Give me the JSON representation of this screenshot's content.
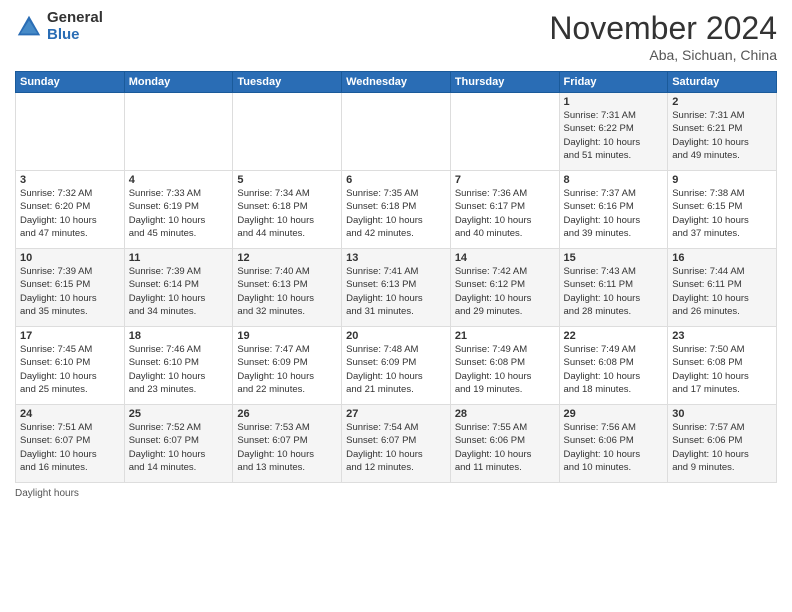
{
  "logo": {
    "general": "General",
    "blue": "Blue"
  },
  "header": {
    "month": "November 2024",
    "location": "Aba, Sichuan, China"
  },
  "days_of_week": [
    "Sunday",
    "Monday",
    "Tuesday",
    "Wednesday",
    "Thursday",
    "Friday",
    "Saturday"
  ],
  "footer": {
    "text": "Daylight hours"
  },
  "weeks": [
    [
      {
        "day": "",
        "detail": ""
      },
      {
        "day": "",
        "detail": ""
      },
      {
        "day": "",
        "detail": ""
      },
      {
        "day": "",
        "detail": ""
      },
      {
        "day": "",
        "detail": ""
      },
      {
        "day": "1",
        "detail": "Sunrise: 7:31 AM\nSunset: 6:22 PM\nDaylight: 10 hours\nand 51 minutes."
      },
      {
        "day": "2",
        "detail": "Sunrise: 7:31 AM\nSunset: 6:21 PM\nDaylight: 10 hours\nand 49 minutes."
      }
    ],
    [
      {
        "day": "3",
        "detail": "Sunrise: 7:32 AM\nSunset: 6:20 PM\nDaylight: 10 hours\nand 47 minutes."
      },
      {
        "day": "4",
        "detail": "Sunrise: 7:33 AM\nSunset: 6:19 PM\nDaylight: 10 hours\nand 45 minutes."
      },
      {
        "day": "5",
        "detail": "Sunrise: 7:34 AM\nSunset: 6:18 PM\nDaylight: 10 hours\nand 44 minutes."
      },
      {
        "day": "6",
        "detail": "Sunrise: 7:35 AM\nSunset: 6:18 PM\nDaylight: 10 hours\nand 42 minutes."
      },
      {
        "day": "7",
        "detail": "Sunrise: 7:36 AM\nSunset: 6:17 PM\nDaylight: 10 hours\nand 40 minutes."
      },
      {
        "day": "8",
        "detail": "Sunrise: 7:37 AM\nSunset: 6:16 PM\nDaylight: 10 hours\nand 39 minutes."
      },
      {
        "day": "9",
        "detail": "Sunrise: 7:38 AM\nSunset: 6:15 PM\nDaylight: 10 hours\nand 37 minutes."
      }
    ],
    [
      {
        "day": "10",
        "detail": "Sunrise: 7:39 AM\nSunset: 6:15 PM\nDaylight: 10 hours\nand 35 minutes."
      },
      {
        "day": "11",
        "detail": "Sunrise: 7:39 AM\nSunset: 6:14 PM\nDaylight: 10 hours\nand 34 minutes."
      },
      {
        "day": "12",
        "detail": "Sunrise: 7:40 AM\nSunset: 6:13 PM\nDaylight: 10 hours\nand 32 minutes."
      },
      {
        "day": "13",
        "detail": "Sunrise: 7:41 AM\nSunset: 6:13 PM\nDaylight: 10 hours\nand 31 minutes."
      },
      {
        "day": "14",
        "detail": "Sunrise: 7:42 AM\nSunset: 6:12 PM\nDaylight: 10 hours\nand 29 minutes."
      },
      {
        "day": "15",
        "detail": "Sunrise: 7:43 AM\nSunset: 6:11 PM\nDaylight: 10 hours\nand 28 minutes."
      },
      {
        "day": "16",
        "detail": "Sunrise: 7:44 AM\nSunset: 6:11 PM\nDaylight: 10 hours\nand 26 minutes."
      }
    ],
    [
      {
        "day": "17",
        "detail": "Sunrise: 7:45 AM\nSunset: 6:10 PM\nDaylight: 10 hours\nand 25 minutes."
      },
      {
        "day": "18",
        "detail": "Sunrise: 7:46 AM\nSunset: 6:10 PM\nDaylight: 10 hours\nand 23 minutes."
      },
      {
        "day": "19",
        "detail": "Sunrise: 7:47 AM\nSunset: 6:09 PM\nDaylight: 10 hours\nand 22 minutes."
      },
      {
        "day": "20",
        "detail": "Sunrise: 7:48 AM\nSunset: 6:09 PM\nDaylight: 10 hours\nand 21 minutes."
      },
      {
        "day": "21",
        "detail": "Sunrise: 7:49 AM\nSunset: 6:08 PM\nDaylight: 10 hours\nand 19 minutes."
      },
      {
        "day": "22",
        "detail": "Sunrise: 7:49 AM\nSunset: 6:08 PM\nDaylight: 10 hours\nand 18 minutes."
      },
      {
        "day": "23",
        "detail": "Sunrise: 7:50 AM\nSunset: 6:08 PM\nDaylight: 10 hours\nand 17 minutes."
      }
    ],
    [
      {
        "day": "24",
        "detail": "Sunrise: 7:51 AM\nSunset: 6:07 PM\nDaylight: 10 hours\nand 16 minutes."
      },
      {
        "day": "25",
        "detail": "Sunrise: 7:52 AM\nSunset: 6:07 PM\nDaylight: 10 hours\nand 14 minutes."
      },
      {
        "day": "26",
        "detail": "Sunrise: 7:53 AM\nSunset: 6:07 PM\nDaylight: 10 hours\nand 13 minutes."
      },
      {
        "day": "27",
        "detail": "Sunrise: 7:54 AM\nSunset: 6:07 PM\nDaylight: 10 hours\nand 12 minutes."
      },
      {
        "day": "28",
        "detail": "Sunrise: 7:55 AM\nSunset: 6:06 PM\nDaylight: 10 hours\nand 11 minutes."
      },
      {
        "day": "29",
        "detail": "Sunrise: 7:56 AM\nSunset: 6:06 PM\nDaylight: 10 hours\nand 10 minutes."
      },
      {
        "day": "30",
        "detail": "Sunrise: 7:57 AM\nSunset: 6:06 PM\nDaylight: 10 hours\nand 9 minutes."
      }
    ]
  ]
}
